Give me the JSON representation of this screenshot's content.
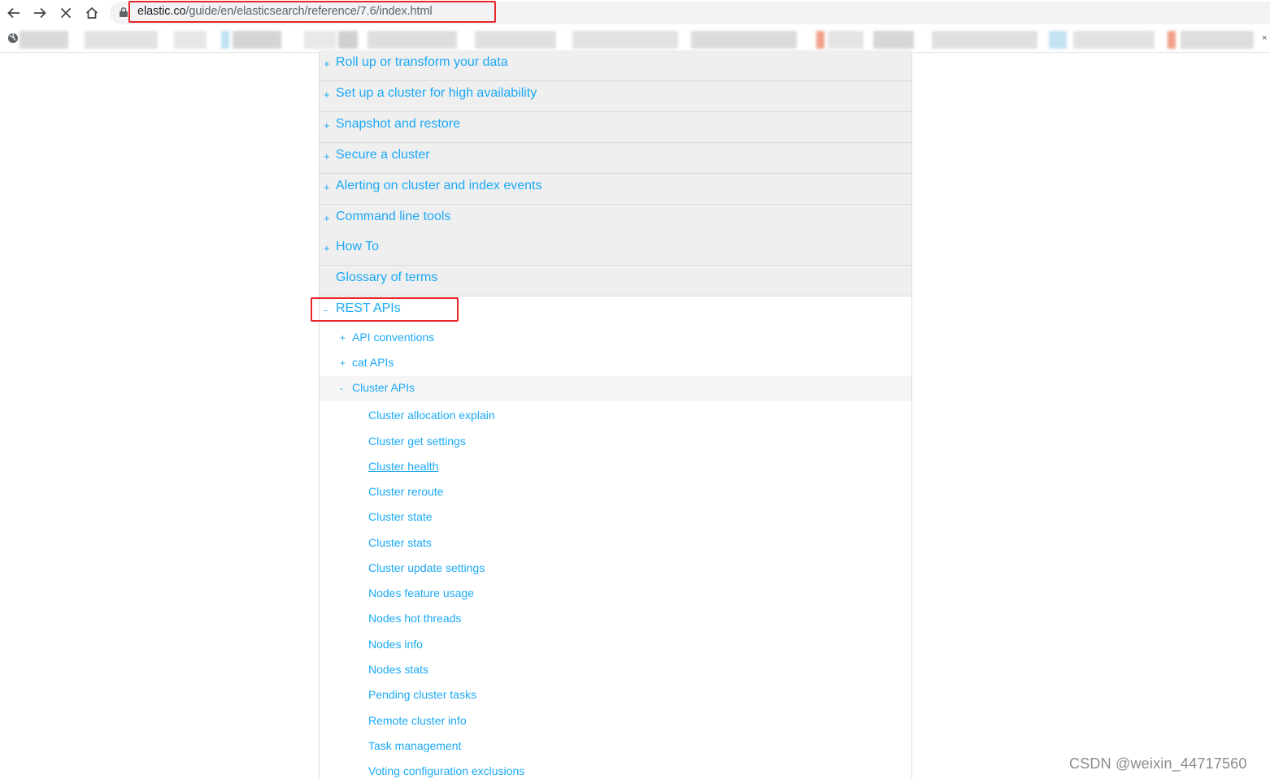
{
  "browser": {
    "url_host": "elastic.co",
    "url_path": "/guide/en/elasticsearch/reference/7.6/index.html",
    "bookmarks_close": "×"
  },
  "toc": {
    "top_items": [
      {
        "sign": "+",
        "label": "Roll up or transform your data"
      },
      {
        "sign": "+",
        "label": "Set up a cluster for high availability"
      },
      {
        "sign": "+",
        "label": "Snapshot and restore"
      },
      {
        "sign": "+",
        "label": "Secure a cluster"
      },
      {
        "sign": "+",
        "label": "Alerting on cluster and index events"
      },
      {
        "sign": "+",
        "label": "Command line tools"
      },
      {
        "sign": "+",
        "label": "How To"
      },
      {
        "sign": "",
        "label": "Glossary of terms"
      }
    ],
    "open_item": {
      "sign": "-",
      "label": "REST APIs"
    },
    "sub_items": [
      {
        "sign": "+",
        "label": "API conventions"
      },
      {
        "sign": "+",
        "label": "cat APIs"
      },
      {
        "sign": "-",
        "label": "Cluster APIs"
      }
    ],
    "leaves": [
      "Cluster allocation explain",
      "Cluster get settings",
      "Cluster health",
      "Cluster reroute",
      "Cluster state",
      "Cluster stats",
      "Cluster update settings",
      "Nodes feature usage",
      "Nodes hot threads",
      "Nodes info",
      "Nodes stats",
      "Pending cluster tasks",
      "Remote cluster info",
      "Task management",
      "Voting configuration exclusions"
    ]
  },
  "watermark": "CSDN @weixin_44717560",
  "colors": {
    "link": "#1ba9f5",
    "highlight": "#e8262a",
    "item_bg": "#efefef"
  }
}
